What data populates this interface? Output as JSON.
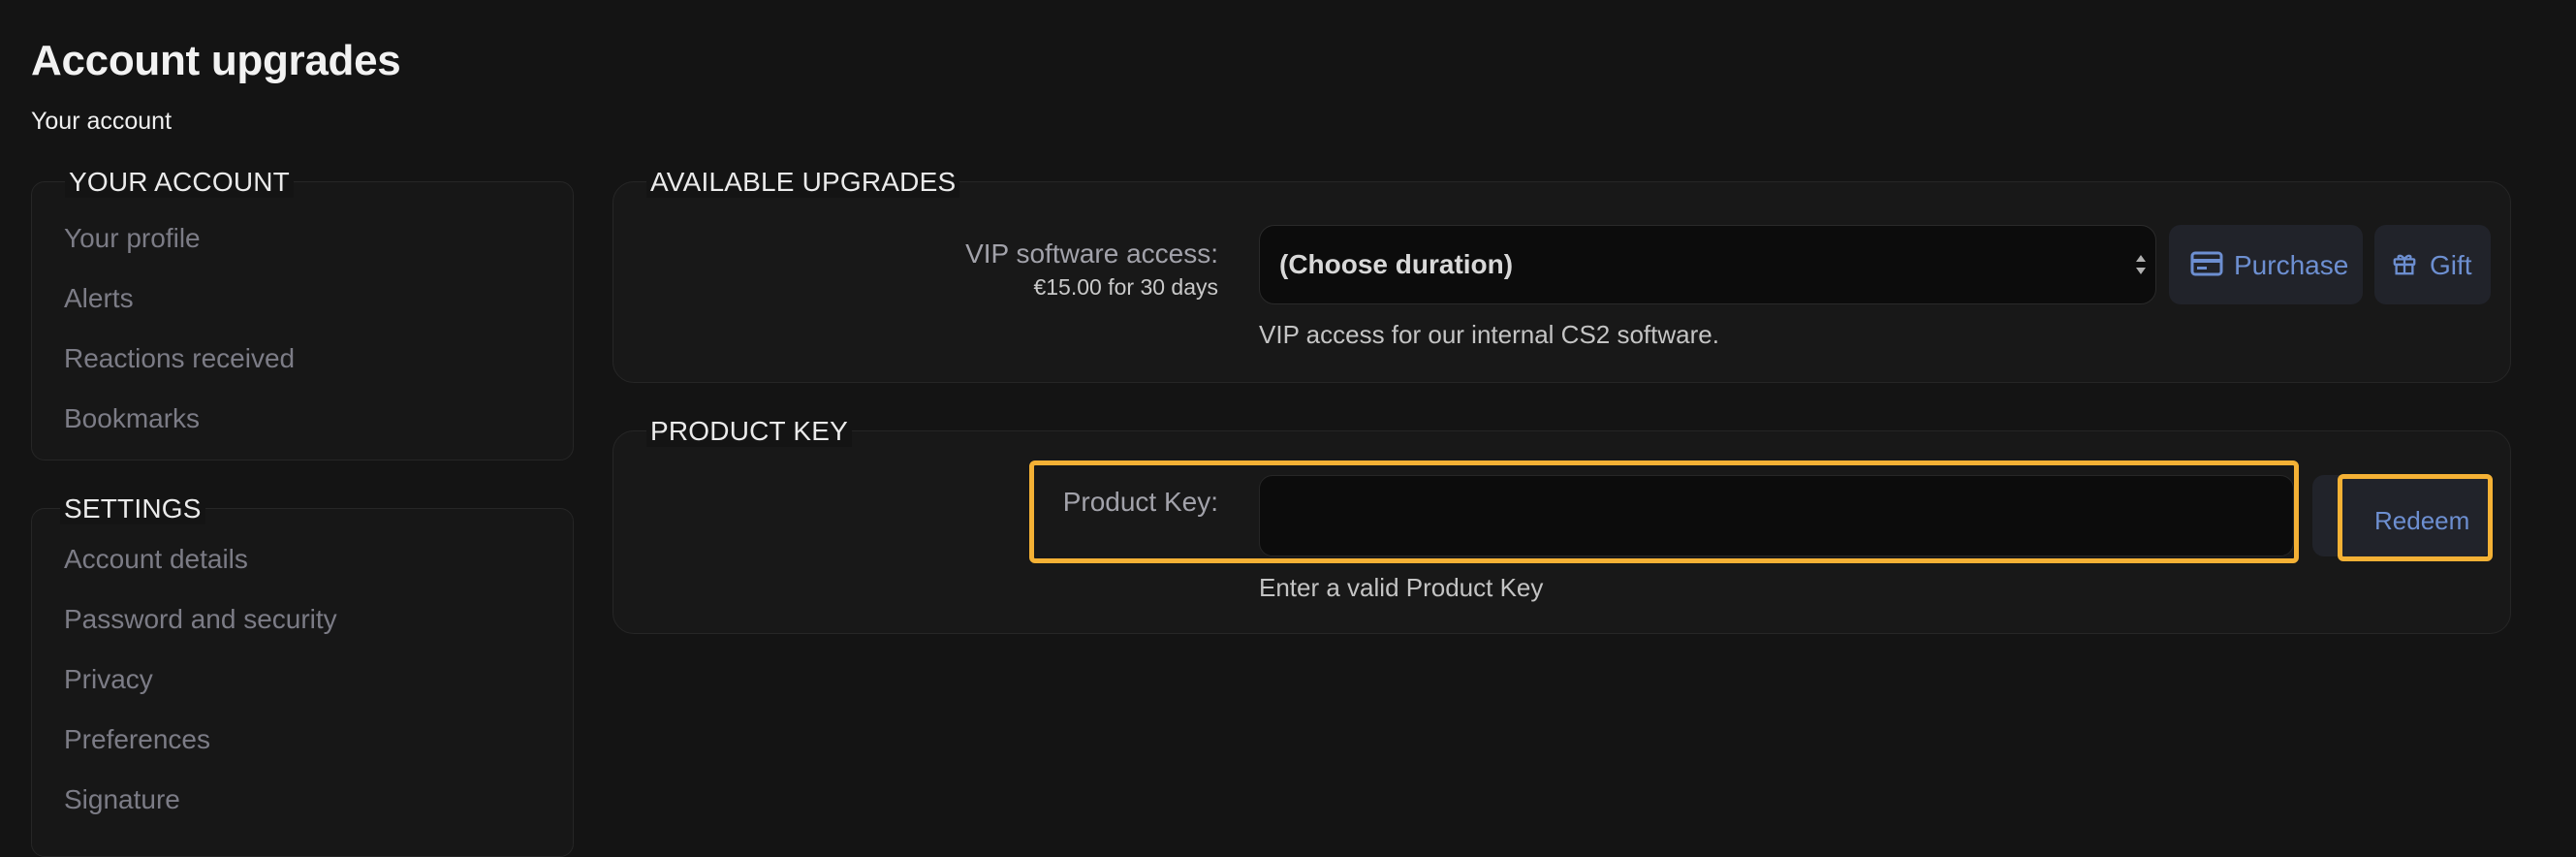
{
  "page": {
    "title": "Account upgrades",
    "breadcrumb": "Your account"
  },
  "sidebar": {
    "your_account": {
      "heading": "YOUR ACCOUNT",
      "items": [
        {
          "label": "Your profile"
        },
        {
          "label": "Alerts"
        },
        {
          "label": "Reactions received"
        },
        {
          "label": "Bookmarks"
        }
      ]
    },
    "settings": {
      "heading": "SETTINGS",
      "items": [
        {
          "label": "Account details"
        },
        {
          "label": "Password and security"
        },
        {
          "label": "Privacy"
        },
        {
          "label": "Preferences"
        },
        {
          "label": "Signature"
        }
      ]
    }
  },
  "upgrades": {
    "heading": "AVAILABLE UPGRADES",
    "vip_label": "VIP software access:",
    "vip_price": "€15.00 for 30 days",
    "duration_select": "(Choose duration)",
    "purchase_label": "Purchase",
    "gift_label": "Gift",
    "description": "VIP access for our internal CS2 software."
  },
  "product_key": {
    "heading": "PRODUCT KEY",
    "label": "Product Key:",
    "value": "",
    "redeem_label": "Redeem",
    "help": "Enter a valid Product Key"
  },
  "colors": {
    "background": "#141414",
    "link_blue": "#6d8fd1",
    "highlight": "#f4b135",
    "muted_text": "#7c7c86"
  },
  "icons": {
    "purchase": "credit-card-icon",
    "gift": "gift-icon",
    "select_arrows": "sort-arrows-icon"
  }
}
